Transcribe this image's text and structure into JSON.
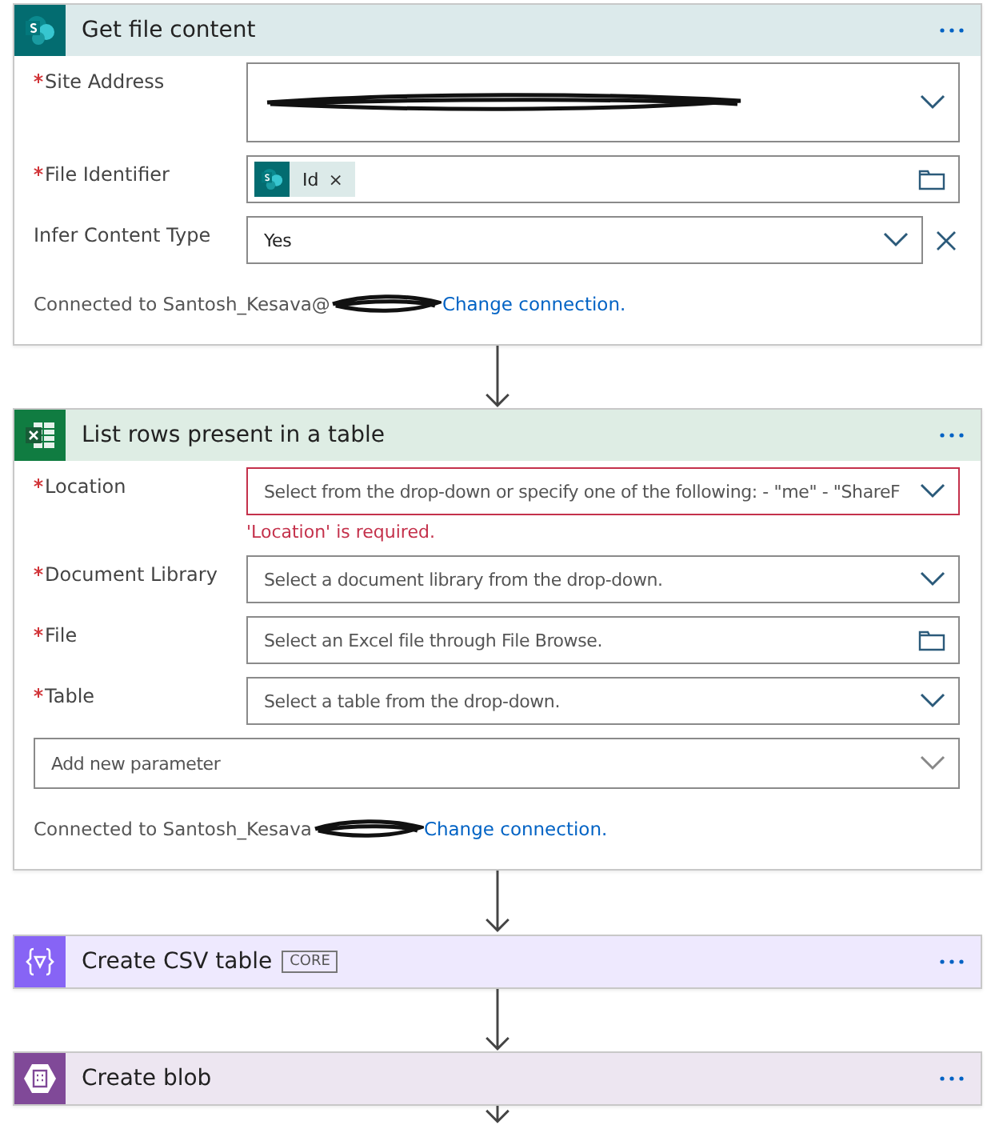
{
  "steps": [
    {
      "kind": "card",
      "color": "#036c70",
      "title": "Get file content",
      "fields": [
        {
          "kind": "redacted",
          "label": "Site Address",
          "required": true
        },
        {
          "kind": "token",
          "label": "File Identifier",
          "required": true,
          "token": "Id",
          "token_close": "×"
        },
        {
          "kind": "dropdown",
          "label": "Infer Content Type",
          "required": false,
          "value": "Yes",
          "removable": true
        }
      ],
      "connection": {
        "prefix": "Connected to Santosh_Kesava@",
        "link": "Change connection."
      }
    },
    {
      "kind": "card",
      "color": "#107c41",
      "title": "List rows present in a table",
      "fields": [
        {
          "kind": "dropdown",
          "label": "Location",
          "required": true,
          "placeholder": "Select from the drop-down or specify one of the following: - \"me\" - \"ShareF",
          "error": "'Location' is required."
        },
        {
          "kind": "dropdown",
          "label": "Document Library",
          "required": true,
          "placeholder": "Select a document library from the drop-down."
        },
        {
          "kind": "file",
          "label": "File",
          "required": true,
          "placeholder": "Select an Excel file through File Browse."
        },
        {
          "kind": "dropdown",
          "label": "Table",
          "required": true,
          "placeholder": "Select a table from the drop-down."
        },
        {
          "kind": "add",
          "placeholder": "Add new parameter"
        }
      ],
      "connection": {
        "prefix": "Connected to Santosh_Kesava",
        "link": "Change connection."
      }
    },
    {
      "kind": "collapsed",
      "color": "#8764f5",
      "title": "Create CSV table",
      "badge": "CORE"
    },
    {
      "kind": "collapsed",
      "color": "#804998",
      "title": "Create blob"
    }
  ]
}
